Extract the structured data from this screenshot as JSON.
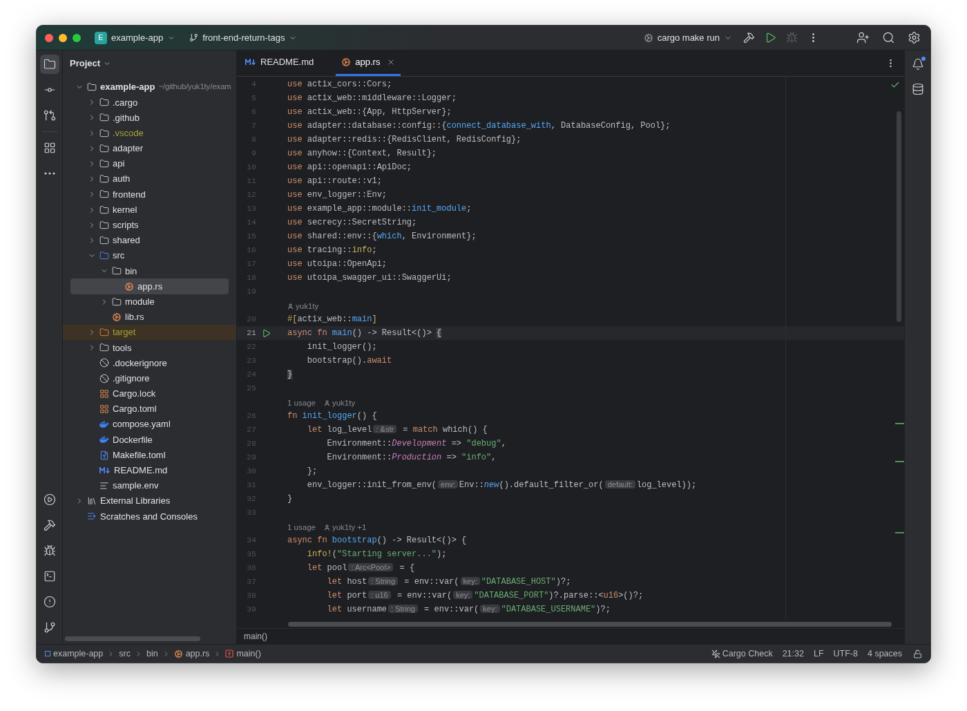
{
  "title_bar": {
    "project": {
      "badge": "E",
      "name": "example-app"
    },
    "branch": "front-end-return-tags",
    "run_config": "cargo make run"
  },
  "tool_strip_top": [
    {
      "kind": "project",
      "selected": true
    },
    {
      "kind": "commit",
      "selected": false
    },
    {
      "kind": "pull-requests",
      "selected": false
    },
    {
      "kind": "structure",
      "selected": false
    },
    {
      "kind": "more",
      "selected": false
    }
  ],
  "tool_strip_bottom": [
    {
      "kind": "services",
      "selected": false
    },
    {
      "kind": "build",
      "selected": false
    },
    {
      "kind": "debug",
      "selected": false
    },
    {
      "kind": "terminal",
      "selected": false
    },
    {
      "kind": "problems",
      "selected": false
    },
    {
      "kind": "git",
      "selected": false
    }
  ],
  "project_panel": {
    "title": "Project",
    "tree": [
      {
        "name": "example-app",
        "path": "~/github/yuk1ty/exam",
        "kind": "folder",
        "expanded": true,
        "selected": false,
        "children": [
          {
            "name": ".cargo",
            "kind": "folder",
            "expanded": false,
            "selected": false
          },
          {
            "name": ".github",
            "kind": "folder",
            "expanded": false,
            "selected": false
          },
          {
            "name": ".vscode",
            "kind": "ignored-folder",
            "expanded": false,
            "selected": false
          },
          {
            "name": "adapter",
            "kind": "folder",
            "expanded": false,
            "selected": false
          },
          {
            "name": "api",
            "kind": "folder",
            "expanded": false,
            "selected": false
          },
          {
            "name": "auth",
            "kind": "folder",
            "expanded": false,
            "selected": false
          },
          {
            "name": "frontend",
            "kind": "folder",
            "expanded": false,
            "selected": false
          },
          {
            "name": "kernel",
            "kind": "folder",
            "expanded": false,
            "selected": false
          },
          {
            "name": "scripts",
            "kind": "folder",
            "expanded": false,
            "selected": false
          },
          {
            "name": "shared",
            "kind": "folder",
            "expanded": false,
            "selected": false
          },
          {
            "name": "src",
            "kind": "source-folder",
            "expanded": true,
            "selected": false,
            "children": [
              {
                "name": "bin",
                "kind": "folder",
                "expanded": true,
                "selected": false,
                "children": [
                  {
                    "name": "app.rs",
                    "kind": "rust",
                    "selected": true
                  }
                ]
              },
              {
                "name": "module",
                "kind": "folder",
                "expanded": false,
                "selected": false
              },
              {
                "name": "lib.rs",
                "kind": "rust",
                "selected": false
              }
            ]
          },
          {
            "name": "target",
            "kind": "excluded-folder",
            "expanded": false,
            "selected": false
          },
          {
            "name": "tools",
            "kind": "folder",
            "expanded": false,
            "selected": false
          },
          {
            "name": ".dockerignore",
            "kind": "ignore",
            "selected": false
          },
          {
            "name": ".gitignore",
            "kind": "ignore",
            "selected": false
          },
          {
            "name": "Cargo.lock",
            "kind": "cargo",
            "selected": false
          },
          {
            "name": "Cargo.toml",
            "kind": "cargo",
            "selected": false
          },
          {
            "name": "compose.yaml",
            "kind": "docker",
            "selected": false
          },
          {
            "name": "Dockerfile",
            "kind": "docker",
            "selected": false
          },
          {
            "name": "Makefile.toml",
            "kind": "toml",
            "selected": false
          },
          {
            "name": "README.md",
            "kind": "markdown",
            "selected": false
          },
          {
            "name": "sample.env",
            "kind": "text",
            "selected": false
          }
        ]
      },
      {
        "name": "External Libraries",
        "kind": "library",
        "expanded": false,
        "selected": false
      },
      {
        "name": "Scratches and Consoles",
        "kind": "scratches",
        "selected": false
      }
    ]
  },
  "tabs": [
    {
      "label": "README.md",
      "kind": "markdown",
      "selected": false,
      "closable": false
    },
    {
      "label": "app.rs",
      "kind": "rust",
      "selected": true,
      "closable": true
    }
  ],
  "editor": {
    "lines": [
      {
        "kind": "code",
        "number": "4",
        "current": false,
        "tokens": [
          {
            "kind": "keyword",
            "text": "use"
          },
          {
            "kind": "plain",
            "text": " actix_cors::Cors;"
          }
        ]
      },
      {
        "kind": "code",
        "number": "5",
        "current": false,
        "tokens": [
          {
            "kind": "keyword",
            "text": "use"
          },
          {
            "kind": "plain",
            "text": " actix_web::middleware::Logger;"
          }
        ]
      },
      {
        "kind": "code",
        "number": "6",
        "current": false,
        "tokens": [
          {
            "kind": "keyword",
            "text": "use"
          },
          {
            "kind": "plain",
            "text": " actix_web::{App, HttpServer};"
          }
        ]
      },
      {
        "kind": "code",
        "number": "7",
        "current": false,
        "tokens": [
          {
            "kind": "keyword",
            "text": "use"
          },
          {
            "kind": "plain",
            "text": " adapter::database::config::{"
          },
          {
            "kind": "function",
            "text": "connect_database_with"
          },
          {
            "kind": "plain",
            "text": ", DatabaseConfig, Pool};"
          }
        ]
      },
      {
        "kind": "code",
        "number": "8",
        "current": false,
        "tokens": [
          {
            "kind": "keyword",
            "text": "use"
          },
          {
            "kind": "plain",
            "text": " adapter::redis::{RedisClient, RedisConfig};"
          }
        ]
      },
      {
        "kind": "code",
        "number": "9",
        "current": false,
        "tokens": [
          {
            "kind": "keyword",
            "text": "use"
          },
          {
            "kind": "plain",
            "text": " anyhow::{Context, Result};"
          }
        ]
      },
      {
        "kind": "code",
        "number": "10",
        "current": false,
        "tokens": [
          {
            "kind": "keyword",
            "text": "use"
          },
          {
            "kind": "plain",
            "text": " api::openapi::ApiDoc;"
          }
        ]
      },
      {
        "kind": "code",
        "number": "11",
        "current": false,
        "tokens": [
          {
            "kind": "keyword",
            "text": "use"
          },
          {
            "kind": "plain",
            "text": " api::route::v1;"
          }
        ]
      },
      {
        "kind": "code",
        "number": "12",
        "current": false,
        "tokens": [
          {
            "kind": "keyword",
            "text": "use"
          },
          {
            "kind": "plain",
            "text": " env_logger::Env;"
          }
        ]
      },
      {
        "kind": "code",
        "number": "13",
        "current": false,
        "tokens": [
          {
            "kind": "keyword",
            "text": "use"
          },
          {
            "kind": "plain",
            "text": " example_app::module::"
          },
          {
            "kind": "function",
            "text": "init_module"
          },
          {
            "kind": "plain",
            "text": ";"
          }
        ]
      },
      {
        "kind": "code",
        "number": "14",
        "current": false,
        "tokens": [
          {
            "kind": "keyword",
            "text": "use"
          },
          {
            "kind": "plain",
            "text": " secrecy::SecretString;"
          }
        ]
      },
      {
        "kind": "code",
        "number": "15",
        "current": false,
        "tokens": [
          {
            "kind": "keyword",
            "text": "use"
          },
          {
            "kind": "plain",
            "text": " shared::env::{"
          },
          {
            "kind": "function",
            "text": "which"
          },
          {
            "kind": "plain",
            "text": ", Environment};"
          }
        ]
      },
      {
        "kind": "code",
        "number": "16",
        "current": false,
        "tokens": [
          {
            "kind": "keyword",
            "text": "use"
          },
          {
            "kind": "plain",
            "text": " tracing::"
          },
          {
            "kind": "macro",
            "text": "info"
          },
          {
            "kind": "plain",
            "text": ";"
          }
        ]
      },
      {
        "kind": "code",
        "number": "17",
        "current": false,
        "tokens": [
          {
            "kind": "keyword",
            "text": "use"
          },
          {
            "kind": "plain",
            "text": " utoipa::OpenApi;"
          }
        ]
      },
      {
        "kind": "code",
        "number": "18",
        "current": false,
        "tokens": [
          {
            "kind": "keyword",
            "text": "use"
          },
          {
            "kind": "plain",
            "text": " utoipa_swagger_ui::SwaggerUi;"
          }
        ]
      },
      {
        "kind": "code",
        "number": "19",
        "current": false
      },
      {
        "kind": "lens",
        "items": [
          {
            "kind": "author",
            "text": "yuk1ty"
          }
        ]
      },
      {
        "kind": "code",
        "number": "20",
        "current": false,
        "tokens": [
          {
            "kind": "macro",
            "text": "#["
          },
          {
            "kind": "plain",
            "text": "actix_web::"
          },
          {
            "kind": "function",
            "text": "main"
          },
          {
            "kind": "macro",
            "text": "]"
          }
        ]
      },
      {
        "kind": "runnable",
        "number": "21",
        "current": true,
        "tokens": [
          {
            "kind": "keyword",
            "text": "async fn "
          },
          {
            "kind": "function",
            "text": "main"
          },
          {
            "kind": "plain",
            "text": "() -> Result<()> "
          },
          {
            "kind": "brace",
            "text": "{"
          }
        ]
      },
      {
        "kind": "code",
        "number": "22",
        "current": false,
        "tokens": [
          {
            "kind": "plain",
            "text": "    init_logger();"
          }
        ]
      },
      {
        "kind": "code",
        "number": "23",
        "current": false,
        "tokens": [
          {
            "kind": "plain",
            "text": "    bootstrap()."
          },
          {
            "kind": "keyword",
            "text": "await"
          }
        ]
      },
      {
        "kind": "code",
        "number": "24",
        "current": false,
        "tokens": [
          {
            "kind": "brace",
            "text": "}"
          }
        ]
      },
      {
        "kind": "code",
        "number": "25",
        "current": false
      },
      {
        "kind": "lens",
        "items": [
          {
            "kind": "usages",
            "text": "1 usage"
          },
          {
            "kind": "author",
            "text": "yuk1ty"
          }
        ]
      },
      {
        "kind": "code",
        "number": "26",
        "current": false,
        "tokens": [
          {
            "kind": "keyword",
            "text": "fn "
          },
          {
            "kind": "function",
            "text": "init_logger"
          },
          {
            "kind": "plain",
            "text": "() {"
          }
        ]
      },
      {
        "kind": "code",
        "number": "27",
        "current": false,
        "tokens": [
          {
            "kind": "keyword",
            "text": "    let"
          },
          {
            "kind": "plain",
            "text": " log_level"
          },
          {
            "kind": "hint",
            "text": ": &str"
          },
          {
            "kind": "plain",
            "text": " = "
          },
          {
            "kind": "keyword",
            "text": "match"
          },
          {
            "kind": "plain",
            "text": " which() {"
          }
        ]
      },
      {
        "kind": "code",
        "number": "28",
        "current": false,
        "tokens": [
          {
            "kind": "plain",
            "text": "        Environment::"
          },
          {
            "kind": "enum",
            "text": "Development"
          },
          {
            "kind": "plain",
            "text": " => "
          },
          {
            "kind": "string",
            "text": "\"debug\""
          },
          {
            "kind": "plain",
            "text": ","
          }
        ]
      },
      {
        "kind": "code",
        "number": "29",
        "current": false,
        "tokens": [
          {
            "kind": "plain",
            "text": "        Environment::"
          },
          {
            "kind": "enum",
            "text": "Production"
          },
          {
            "kind": "plain",
            "text": " => "
          },
          {
            "kind": "string",
            "text": "\"info\""
          },
          {
            "kind": "plain",
            "text": ","
          }
        ]
      },
      {
        "kind": "code",
        "number": "30",
        "current": false,
        "tokens": [
          {
            "kind": "plain",
            "text": "    };"
          }
        ]
      },
      {
        "kind": "code",
        "number": "31",
        "current": false,
        "tokens": [
          {
            "kind": "plain",
            "text": "    env_logger::init_from_env("
          },
          {
            "kind": "hint",
            "text": "env:"
          },
          {
            "kind": "plain",
            "text": "Env::"
          },
          {
            "kind": "call-italic",
            "text": "new"
          },
          {
            "kind": "plain",
            "text": "().default_filter_or("
          },
          {
            "kind": "hint",
            "text": "default:"
          },
          {
            "kind": "plain",
            "text": "log_level));"
          }
        ]
      },
      {
        "kind": "code",
        "number": "32",
        "current": false,
        "tokens": [
          {
            "kind": "plain",
            "text": "}"
          }
        ]
      },
      {
        "kind": "code",
        "number": "33",
        "current": false
      },
      {
        "kind": "lens",
        "items": [
          {
            "kind": "usages",
            "text": "1 usage"
          },
          {
            "kind": "author",
            "text": "yuk1ty +1"
          }
        ]
      },
      {
        "kind": "code",
        "number": "34",
        "current": false,
        "tokens": [
          {
            "kind": "keyword",
            "text": "async fn "
          },
          {
            "kind": "function",
            "text": "bootstrap"
          },
          {
            "kind": "plain",
            "text": "() -> Result<()> {"
          }
        ]
      },
      {
        "kind": "code",
        "number": "35",
        "current": false,
        "tokens": [
          {
            "kind": "macro",
            "text": "    info!"
          },
          {
            "kind": "plain",
            "text": "("
          },
          {
            "kind": "string",
            "text": "\"Starting server...\""
          },
          {
            "kind": "plain",
            "text": ");"
          }
        ]
      },
      {
        "kind": "code",
        "number": "36",
        "current": false,
        "tokens": [
          {
            "kind": "keyword",
            "text": "    let"
          },
          {
            "kind": "plain",
            "text": " pool"
          },
          {
            "kind": "hint",
            "text": ": Arc<Pool>"
          },
          {
            "kind": "plain",
            "text": " = {"
          }
        ]
      },
      {
        "kind": "code",
        "number": "37",
        "current": false,
        "tokens": [
          {
            "kind": "keyword",
            "text": "        let"
          },
          {
            "kind": "plain",
            "text": " host"
          },
          {
            "kind": "hint",
            "text": ": String"
          },
          {
            "kind": "plain",
            "text": " = env::var("
          },
          {
            "kind": "hint",
            "text": "key:"
          },
          {
            "kind": "string",
            "text": "\"DATABASE_HOST\""
          },
          {
            "kind": "plain",
            "text": ")?;"
          }
        ]
      },
      {
        "kind": "code",
        "number": "38",
        "current": false,
        "tokens": [
          {
            "kind": "keyword",
            "text": "        let"
          },
          {
            "kind": "plain",
            "text": " port"
          },
          {
            "kind": "hint",
            "text": ": u16"
          },
          {
            "kind": "plain",
            "text": " = env::var("
          },
          {
            "kind": "hint",
            "text": "key:"
          },
          {
            "kind": "string",
            "text": "\"DATABASE_PORT\""
          },
          {
            "kind": "plain",
            "text": ")?.parse::<"
          },
          {
            "kind": "keyword",
            "text": "u16"
          },
          {
            "kind": "plain",
            "text": ">()?;"
          }
        ]
      },
      {
        "kind": "code",
        "number": "39",
        "current": false,
        "tokens": [
          {
            "kind": "keyword",
            "text": "        let"
          },
          {
            "kind": "plain",
            "text": " username"
          },
          {
            "kind": "hint",
            "text": ": String"
          },
          {
            "kind": "plain",
            "text": " = env::var("
          },
          {
            "kind": "hint",
            "text": "key:"
          },
          {
            "kind": "string",
            "text": "\"DATABASE_USERNAME\""
          },
          {
            "kind": "plain",
            "text": ")?;"
          }
        ]
      }
    ],
    "breadcrumb": "main()"
  },
  "right_strip": [
    {
      "kind": "notifications",
      "badge": true
    },
    {
      "kind": "database",
      "badge": false
    }
  ],
  "status_bar": {
    "path": [
      {
        "kind": "module",
        "label": "example-app"
      },
      {
        "kind": "directory",
        "label": "src"
      },
      {
        "kind": "directory",
        "label": "bin"
      },
      {
        "kind": "rust",
        "label": "app.rs"
      },
      {
        "kind": "function",
        "label": "main()"
      }
    ],
    "items": [
      {
        "kind": "cargo-check",
        "label": "Cargo Check"
      },
      {
        "kind": "text",
        "label": "21:32"
      },
      {
        "kind": "text",
        "label": "LF"
      },
      {
        "kind": "text",
        "label": "UTF-8"
      },
      {
        "kind": "text",
        "label": "4 spaces"
      }
    ]
  }
}
